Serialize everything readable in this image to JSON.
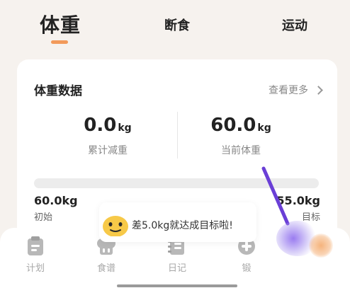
{
  "tabs": {
    "weight": "体重",
    "fasting": "断食",
    "exercise": "运动"
  },
  "card": {
    "title": "体重数据",
    "see_more": "查看更多",
    "lost": {
      "value": "0.0",
      "unit": "kg",
      "label": "累计减重"
    },
    "current": {
      "value": "60.0",
      "unit": "kg",
      "label": "当前体重"
    },
    "progress_fraction": 0,
    "start": {
      "value": "60.0kg",
      "label": "初始"
    },
    "target": {
      "value": "55.0kg",
      "label": "目标"
    }
  },
  "toast": {
    "text": "差5.0kg就达成目标啦!"
  },
  "bottom_nav": {
    "plan": "计划",
    "recipe": "食谱",
    "diary": "日记",
    "exercise": "锻"
  },
  "colors": {
    "accent": "#f29a5a",
    "background": "#f6f2ee",
    "annotation": "#6a3fd6"
  }
}
